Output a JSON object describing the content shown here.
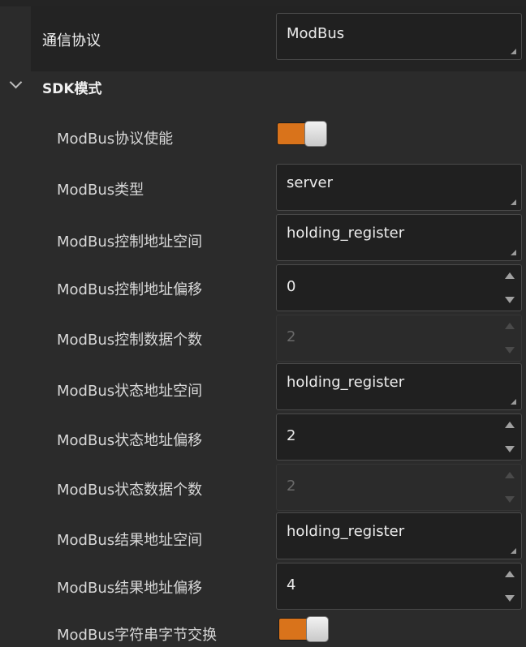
{
  "protocol": {
    "label": "通信协议",
    "value": "ModBus"
  },
  "section": {
    "title": "SDK模式"
  },
  "rows": [
    {
      "label": "ModBus协议使能",
      "kind": "toggle",
      "on": true
    },
    {
      "label": "ModBus类型",
      "kind": "dropdown",
      "value": "server"
    },
    {
      "label": "ModBus控制地址空间",
      "kind": "dropdown",
      "value": "holding_register"
    },
    {
      "label": "ModBus控制地址偏移",
      "kind": "spinbox",
      "value": "0"
    },
    {
      "label": "ModBus控制数据个数",
      "kind": "spinbox-disabled",
      "value": "2"
    },
    {
      "label": "ModBus状态地址空间",
      "kind": "dropdown",
      "value": "holding_register"
    },
    {
      "label": "ModBus状态地址偏移",
      "kind": "spinbox",
      "value": "2"
    },
    {
      "label": "ModBus状态数据个数",
      "kind": "spinbox-disabled",
      "value": "2"
    },
    {
      "label": "ModBus结果地址空间",
      "kind": "dropdown",
      "value": "holding_register"
    },
    {
      "label": "ModBus结果地址偏移",
      "kind": "spinbox",
      "value": "4"
    },
    {
      "label": "ModBus字符串字节交换",
      "kind": "toggle",
      "on": true
    }
  ],
  "colors": {
    "accent": "#d9731b",
    "background": "#2b2b2b",
    "field": "#202020"
  }
}
